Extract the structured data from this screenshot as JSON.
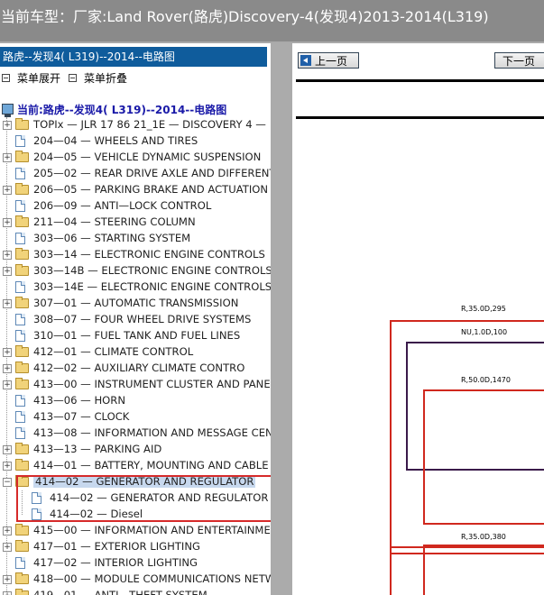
{
  "title_bar": "当前车型：厂家:Land Rover(路虎)Discovery-4(发现4)2013-2014(L319)",
  "panel": {
    "header": "路虎--发现4( L319)--2014--电路图",
    "expand_label": "菜单展开",
    "collapse_label": "菜单折叠",
    "current_label": "当前:路虎--发现4( L319)--2014--电路图"
  },
  "tree": [
    {
      "label": "TOPIx — JLR 17 86 21_1E — DISCOVERY 4 —",
      "type": "folder"
    },
    {
      "label": "204—04 — WHEELS AND TIRES",
      "type": "doc"
    },
    {
      "label": "204—05 — VEHICLE DYNAMIC SUSPENSION",
      "type": "folder"
    },
    {
      "label": "205—02 — REAR DRIVE AXLE AND DIFFERENT",
      "type": "doc"
    },
    {
      "label": "206—05 — PARKING BRAKE AND ACTUATION",
      "type": "folder"
    },
    {
      "label": "206—09 — ANTI—LOCK CONTROL",
      "type": "doc"
    },
    {
      "label": "211—04 — STEERING COLUMN",
      "type": "folder"
    },
    {
      "label": "303—06 — STARTING SYSTEM",
      "type": "doc"
    },
    {
      "label": "303—14 — ELECTRONIC ENGINE CONTROLS",
      "type": "folder"
    },
    {
      "label": "303—14B — ELECTRONIC ENGINE CONTROLS",
      "type": "folder"
    },
    {
      "label": "303—14E — ELECTRONIC ENGINE CONTROLS",
      "type": "doc"
    },
    {
      "label": "307—01 — AUTOMATIC TRANSMISSION",
      "type": "folder"
    },
    {
      "label": "308—07 — FOUR WHEEL DRIVE SYSTEMS",
      "type": "doc"
    },
    {
      "label": "310—01 — FUEL TANK AND FUEL LINES",
      "type": "doc"
    },
    {
      "label": "412—01 — CLIMATE CONTROL",
      "type": "folder"
    },
    {
      "label": "412—02 — AUXILIARY CLIMATE CONTRO",
      "type": "folder"
    },
    {
      "label": "413—00 — INSTRUMENT CLUSTER AND PANE",
      "type": "folder"
    },
    {
      "label": "413—06 — HORN",
      "type": "doc"
    },
    {
      "label": "413—07 — CLOCK",
      "type": "doc"
    },
    {
      "label": "413—08 — INFORMATION AND MESSAGE CEN",
      "type": "doc"
    },
    {
      "label": "413—13 — PARKING AID",
      "type": "folder"
    },
    {
      "label": "414—01 — BATTERY, MOUNTING AND CABLE",
      "type": "folder"
    },
    {
      "label": "414—02 — GENERATOR AND REGULATOR",
      "type": "folder-open",
      "selected": true
    },
    {
      "label": "414—02 — GENERATOR AND REGULATOR",
      "type": "doc",
      "child": true
    },
    {
      "label": "414—02 — Diesel",
      "type": "doc",
      "child": true
    },
    {
      "label": "415—00 — INFORMATION AND ENTERTAINME",
      "type": "folder"
    },
    {
      "label": "417—01 — EXTERIOR LIGHTING",
      "type": "folder"
    },
    {
      "label": "417—02 — INTERIOR LIGHTING",
      "type": "doc"
    },
    {
      "label": "418—00 — MODULE COMMUNICATIONS NETW",
      "type": "folder"
    },
    {
      "label": "419—01 — ANTI—THEFT SYSTEM",
      "type": "folder"
    }
  ],
  "viewer": {
    "prev_label": "上一页",
    "next_label": "下一页",
    "labels": [
      "R,35.0D,295",
      "NU,1.0D,100",
      "R,50.0D,1470",
      "R,35.0D,380"
    ]
  },
  "colors": {
    "accent": "#0f5c9c",
    "highlight": "#d62a2a",
    "wire_red": "#d0281e",
    "wire_purple": "#3a1a4a"
  }
}
